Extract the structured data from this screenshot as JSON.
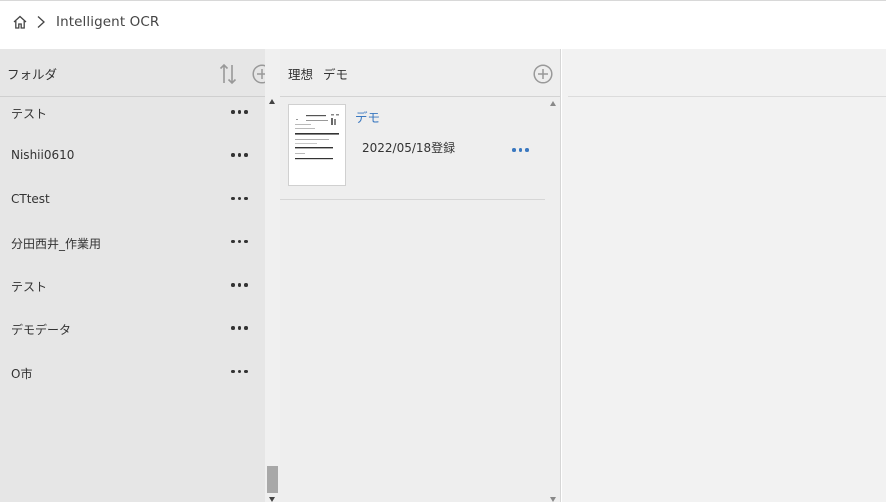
{
  "breadcrumb": {
    "home_icon": "home-icon",
    "separator": ">",
    "title": "Intelligent OCR"
  },
  "folders": {
    "header_label": "フォルダ",
    "sort_icon": "sort-icon",
    "add_icon": "add-circle-icon",
    "items": [
      {
        "label": "テスト"
      },
      {
        "label": "Nishii0610"
      },
      {
        "label": "CTtest"
      },
      {
        "label": "分田西井_作業用"
      },
      {
        "label": "テスト"
      },
      {
        "label": "デモデータ"
      },
      {
        "label": "O市"
      }
    ]
  },
  "documents": {
    "path": [
      "理想",
      "デモ"
    ],
    "add_icon": "add-circle-icon",
    "items": [
      {
        "name": "デモ",
        "date": "2022/05/18登録"
      }
    ]
  },
  "colors": {
    "accent": "#3a78c0",
    "folder_bg": "#e6e6e6",
    "docs_bg": "#eeeeee",
    "preview_bg": "#f2f2f2"
  }
}
